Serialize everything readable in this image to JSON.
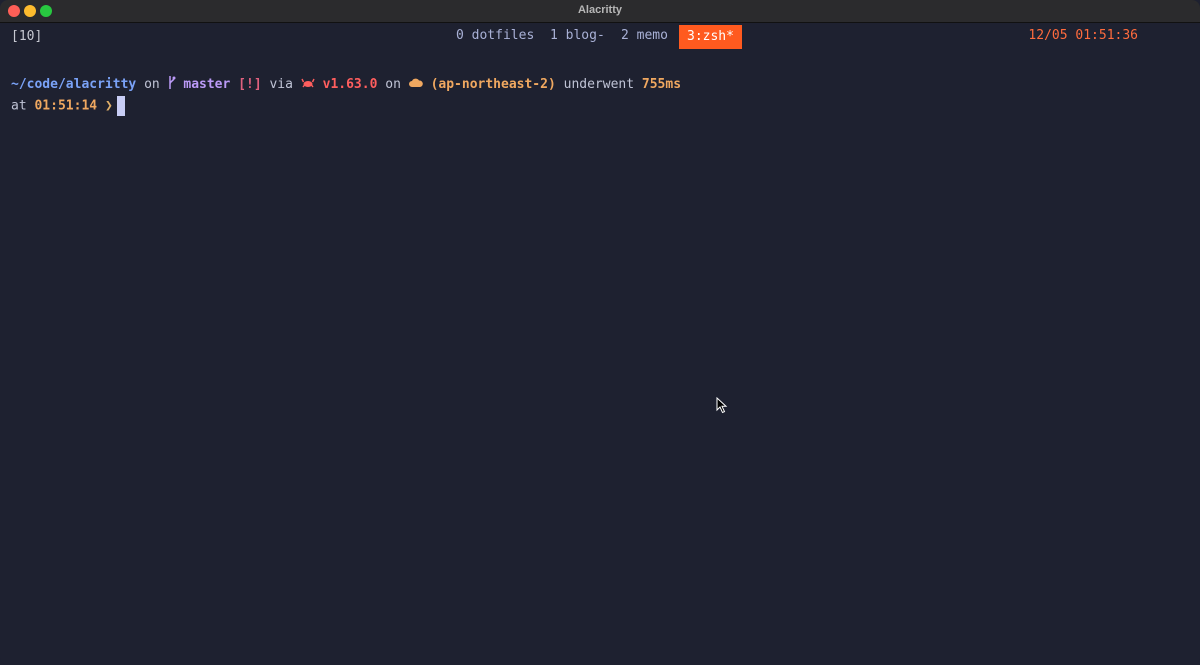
{
  "window": {
    "title": "Alacritty"
  },
  "tmux": {
    "session": "[10]",
    "windows": [
      {
        "label": "0 dotfiles",
        "active": false
      },
      {
        "label": "1 blog-",
        "active": false
      },
      {
        "label": "2 memo",
        "active": false
      },
      {
        "label": "3:zsh*",
        "active": true
      }
    ],
    "clock": "12/05 01:51:36",
    "active_color": "#ff5a1f"
  },
  "prompt": {
    "path": "~/code/alacritty",
    "on1": "on",
    "branch_icon": "git-branch-icon",
    "branch": "master",
    "git_status": "[!]",
    "via": "via",
    "rust_icon": "crab-icon",
    "rust_version": "v1.63.0",
    "on2": "on",
    "aws_icon": "cloud-icon",
    "aws_region": "(ap-northeast-2)",
    "underwent": "underwent",
    "duration": "755ms",
    "at": "at",
    "time": "01:51:14",
    "symbol": "❯"
  }
}
